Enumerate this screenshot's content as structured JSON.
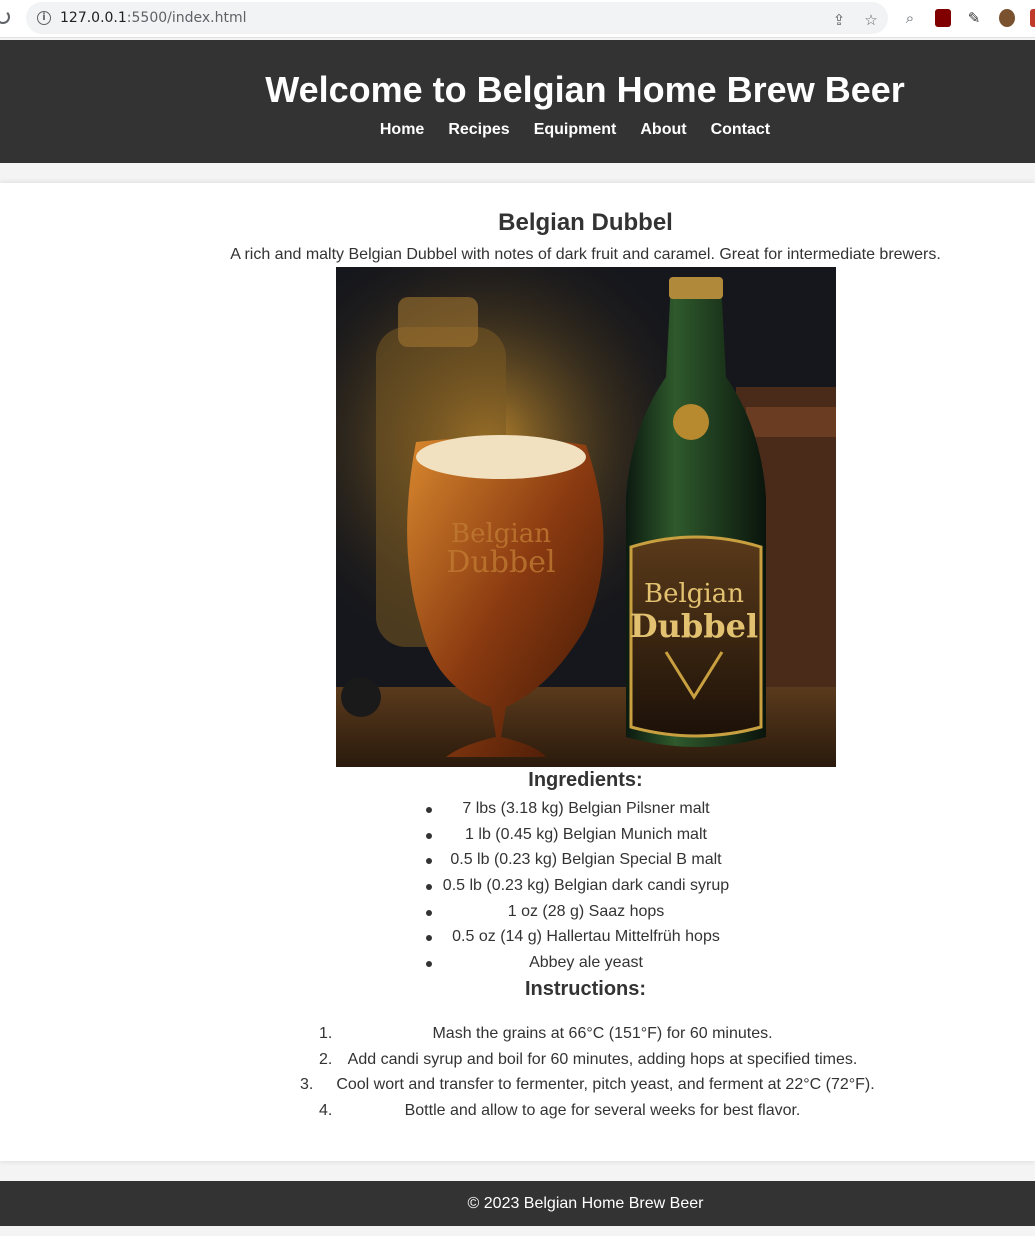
{
  "browser": {
    "url_host": "127.0.0.1",
    "url_rest": ":5500/index.html"
  },
  "header": {
    "title": "Welcome to Belgian Home Brew Beer",
    "nav": [
      "Home",
      "Recipes",
      "Equipment",
      "About",
      "Contact"
    ]
  },
  "recipe": {
    "title": "Belgian Dubbel",
    "description": "A rich and malty Belgian Dubbel with notes of dark fruit and caramel. Great for intermediate brewers.",
    "image_label_line1": "Belgian",
    "image_label_line2": "Dubbel",
    "ingredients_heading": "Ingredients:",
    "ingredients": [
      "7 lbs (3.18 kg) Belgian Pilsner malt",
      "1 lb (0.45 kg) Belgian Munich malt",
      "0.5 lb (0.23 kg) Belgian Special B malt",
      "0.5 lb (0.23 kg) Belgian dark candi syrup",
      "1 oz (28 g) Saaz hops",
      "0.5 oz (14 g) Hallertau Mittelfrüh hops",
      "Abbey ale yeast"
    ],
    "instructions_heading": "Instructions:",
    "instructions": [
      {
        "num": "1.",
        "text": "Mash the grains at 66°C (151°F) for 60 minutes."
      },
      {
        "num": "2.",
        "text": "Add candi syrup and boil for 60 minutes, adding hops at specified times."
      },
      {
        "num": "3.",
        "text": "Cool wort and transfer to fermenter, pitch yeast, and ferment at 22°C (72°F)."
      },
      {
        "num": "4.",
        "text": "Bottle and allow to age for several weeks for best flavor."
      }
    ]
  },
  "footer": {
    "text": "© 2023 Belgian Home Brew Beer"
  },
  "colors": {
    "header_bg": "#333333",
    "page_bg": "#f4f4f4",
    "card_bg": "#ffffff",
    "text": "#333333"
  }
}
